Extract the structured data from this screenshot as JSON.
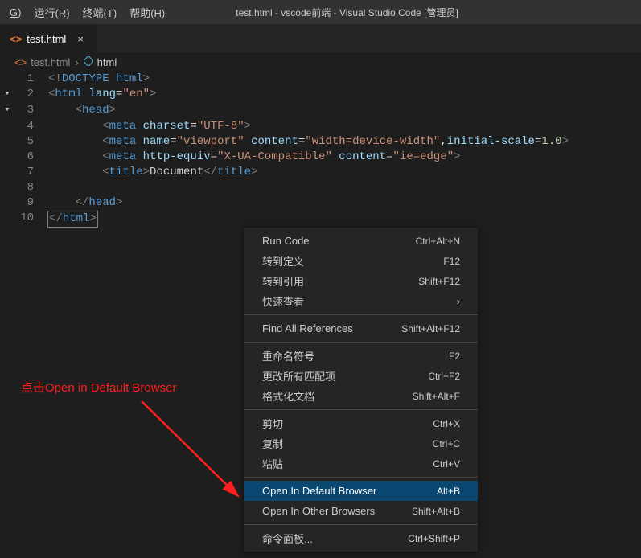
{
  "menubar": {
    "items": [
      {
        "pre": "",
        "mn": "G",
        "post": ")"
      },
      {
        "pre": "运行(",
        "mn": "R",
        "post": ")"
      },
      {
        "pre": "终端(",
        "mn": "T",
        "post": ")"
      },
      {
        "pre": "帮助(",
        "mn": "H",
        "post": ")"
      }
    ],
    "title": "test.html - vscode前端 - Visual Studio Code [管理员]"
  },
  "tab": {
    "icon": "<>",
    "label": "test.html",
    "close": "×"
  },
  "breadcrumb": {
    "icon1": "<>",
    "seg1": "test.html",
    "sep": "›",
    "icon2": "▫",
    "seg2": "html"
  },
  "code": {
    "lines": [
      {
        "n": "1",
        "fold": "",
        "tokens": [
          [
            "<!",
            "gray"
          ],
          [
            "DOCTYPE ",
            "doct"
          ],
          [
            "html",
            "tag"
          ],
          [
            ">",
            "gray"
          ]
        ],
        "indent": 0
      },
      {
        "n": "2",
        "fold": "▾",
        "tokens": [
          [
            "<",
            "gray"
          ],
          [
            "html ",
            "tag"
          ],
          [
            "lang",
            "attr"
          ],
          [
            "=",
            "op"
          ],
          [
            "\"en\"",
            "str"
          ],
          [
            ">",
            "gray"
          ]
        ],
        "indent": 0
      },
      {
        "n": "3",
        "fold": "▾",
        "tokens": [
          [
            "<",
            "gray"
          ],
          [
            "head",
            "tag"
          ],
          [
            ">",
            "gray"
          ]
        ],
        "indent": 1
      },
      {
        "n": "4",
        "fold": "",
        "tokens": [
          [
            "<",
            "gray"
          ],
          [
            "meta ",
            "tag"
          ],
          [
            "charset",
            "attr"
          ],
          [
            "=",
            "op"
          ],
          [
            "\"UTF-8\"",
            "str"
          ],
          [
            ">",
            "gray"
          ]
        ],
        "indent": 2
      },
      {
        "n": "5",
        "fold": "",
        "tokens": [
          [
            "<",
            "gray"
          ],
          [
            "meta ",
            "tag"
          ],
          [
            "name",
            "attr"
          ],
          [
            "=",
            "op"
          ],
          [
            "\"viewport\" ",
            "str"
          ],
          [
            "content",
            "attr"
          ],
          [
            "=",
            "op"
          ],
          [
            "\"width=device-width\"",
            "str"
          ],
          [
            ",",
            "text"
          ],
          [
            "initial-scale",
            "attr"
          ],
          [
            "=",
            "op"
          ],
          [
            "1.0",
            "num"
          ],
          [
            ">",
            "gray"
          ]
        ],
        "indent": 2
      },
      {
        "n": "6",
        "fold": "",
        "tokens": [
          [
            "<",
            "gray"
          ],
          [
            "meta ",
            "tag"
          ],
          [
            "http-equiv",
            "attr"
          ],
          [
            "=",
            "op"
          ],
          [
            "\"X-UA-Compatible\" ",
            "str"
          ],
          [
            "content",
            "attr"
          ],
          [
            "=",
            "op"
          ],
          [
            "\"ie=edge\"",
            "str"
          ],
          [
            ">",
            "gray"
          ]
        ],
        "indent": 2
      },
      {
        "n": "7",
        "fold": "",
        "tokens": [
          [
            "<",
            "gray"
          ],
          [
            "title",
            "tag"
          ],
          [
            ">",
            "gray"
          ],
          [
            "Document",
            "text"
          ],
          [
            "</",
            "gray"
          ],
          [
            "title",
            "tag"
          ],
          [
            ">",
            "gray"
          ]
        ],
        "indent": 2
      },
      {
        "n": "8",
        "fold": "",
        "tokens": [],
        "indent": 0
      },
      {
        "n": "9",
        "fold": "",
        "tokens": [
          [
            "</",
            "gray"
          ],
          [
            "head",
            "tag"
          ],
          [
            ">",
            "gray"
          ]
        ],
        "indent": 1
      },
      {
        "n": "10",
        "fold": "",
        "tokens": [
          [
            "</",
            "gray",
            "selstart"
          ],
          [
            "html",
            "tag"
          ],
          [
            ">",
            "gray",
            "selend"
          ]
        ],
        "indent": 0
      }
    ]
  },
  "ctx": {
    "items": [
      {
        "type": "item",
        "label": "Run Code",
        "kb": "Ctrl+Alt+N"
      },
      {
        "type": "item",
        "label": "转到定义",
        "kb": "F12"
      },
      {
        "type": "item",
        "label": "转到引用",
        "kb": "Shift+F12"
      },
      {
        "type": "sub",
        "label": "快速查看",
        "kb": "›"
      },
      {
        "type": "sep"
      },
      {
        "type": "item",
        "label": "Find All References",
        "kb": "Shift+Alt+F12"
      },
      {
        "type": "sep"
      },
      {
        "type": "item",
        "label": "重命名符号",
        "kb": "F2"
      },
      {
        "type": "item",
        "label": "更改所有匹配项",
        "kb": "Ctrl+F2"
      },
      {
        "type": "item",
        "label": "格式化文档",
        "kb": "Shift+Alt+F"
      },
      {
        "type": "sep"
      },
      {
        "type": "item",
        "label": "剪切",
        "kb": "Ctrl+X"
      },
      {
        "type": "item",
        "label": "复制",
        "kb": "Ctrl+C"
      },
      {
        "type": "item",
        "label": "粘贴",
        "kb": "Ctrl+V"
      },
      {
        "type": "sep"
      },
      {
        "type": "item",
        "label": "Open In Default Browser",
        "kb": "Alt+B",
        "hl": true
      },
      {
        "type": "item",
        "label": "Open In Other Browsers",
        "kb": "Shift+Alt+B"
      },
      {
        "type": "sep"
      },
      {
        "type": "item",
        "label": "命令面板...",
        "kb": "Ctrl+Shift+P"
      }
    ]
  },
  "annotation": "点击Open in Default Browser"
}
